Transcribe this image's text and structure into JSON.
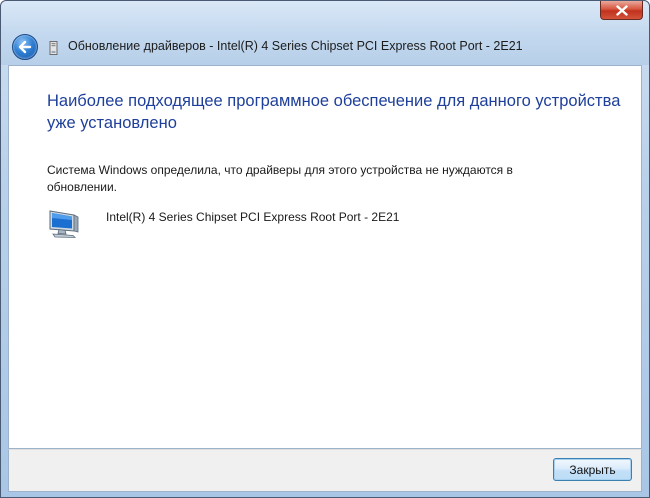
{
  "window": {
    "title": "Обновление драйверов - Intel(R) 4 Series Chipset PCI Express Root Port - 2E21"
  },
  "icons": {
    "back": "back-arrow-icon",
    "title": "device-icon",
    "close": "close-icon",
    "device": "monitor-device-icon"
  },
  "content": {
    "heading": "Наиболее подходящее программное обеспечение для данного устройства уже установлено",
    "message": "Система Windows определила, что драйверы для этого устройства не нуждаются в обновлении.",
    "device_name": "Intel(R) 4 Series Chipset PCI Express Root Port - 2E21"
  },
  "footer": {
    "close_label": "Закрыть"
  },
  "colors": {
    "heading": "#1e3f9a",
    "frame": "#b9d1ea",
    "close_button": "#c1321e"
  }
}
